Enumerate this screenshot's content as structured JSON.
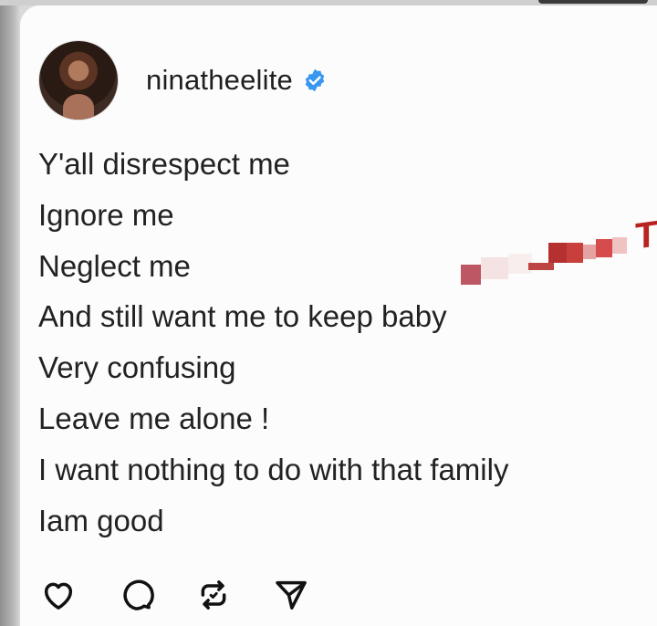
{
  "post": {
    "username": "ninatheelite",
    "verified": true,
    "lines": [
      "Y'all disrespect me",
      "Ignore me",
      "Neglect me",
      "And still want me to keep baby",
      "Very confusing",
      "Leave me alone !",
      "I want nothing to do with that family",
      "Iam good"
    ]
  },
  "overlay": {
    "watermark_fragment": "T"
  },
  "actions": {
    "like_icon": "heart-icon",
    "comment_icon": "comment-icon",
    "repost_icon": "repost-icon",
    "share_icon": "send-icon"
  },
  "colors": {
    "verified_badge": "#3897f0",
    "watermark": "#b8231f",
    "text": "#222222"
  }
}
